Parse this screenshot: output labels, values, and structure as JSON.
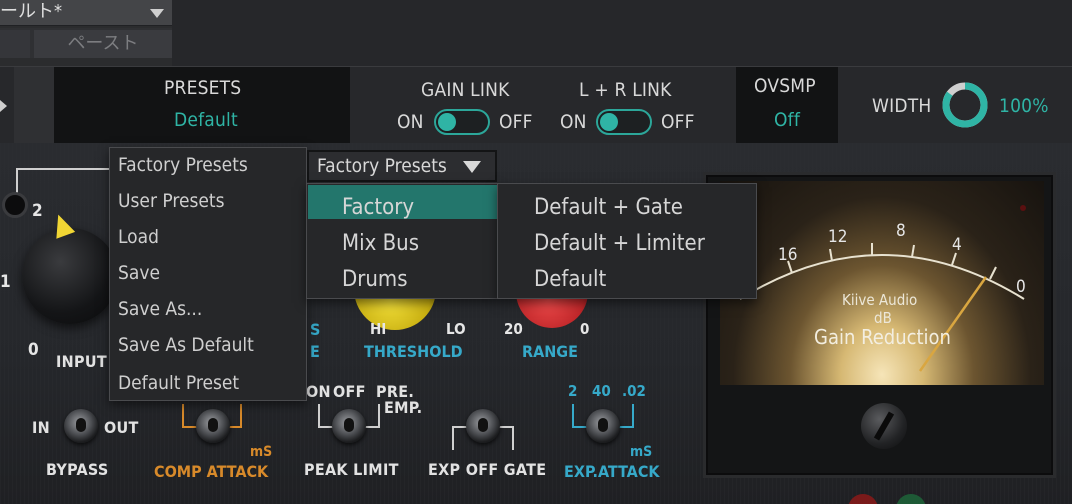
{
  "host": {
    "preset_name": "ールト*",
    "paste_label": "ペースト"
  },
  "topbar": {
    "presets_label": "PRESETS",
    "presets_value": "Default",
    "gain_link_label": "GAIN LINK",
    "gain_link_on": "ON",
    "gain_link_off": "OFF",
    "lr_link_label": "L + R LINK",
    "lr_link_on": "ON",
    "lr_link_off": "OFF",
    "ovsmp_label": "OVSMP",
    "ovsmp_value": "Off",
    "width_label": "WIDTH",
    "width_value": "100%",
    "width_level": 0.85
  },
  "controls": {
    "input_label": "INPUT",
    "input_scale": [
      "2",
      "1",
      "0"
    ],
    "bypass_label": "BYPASS",
    "bypass_in": "IN",
    "bypass_out": "OUT",
    "comp_attack_label": "COMP ATTACK",
    "comp_attack_unit": "mS",
    "peak_limit_label": "PEAK LIMIT",
    "peak_on": "ON",
    "peak_off": "OFF",
    "peak_pre": "PRE.",
    "peak_emp": "EMP.",
    "exp_gate_label": "EXP OFF GATE",
    "exp_attack_label": "EXP.ATTACK",
    "exp_attack_scale": [
      "2",
      "40",
      ".02"
    ],
    "exp_attack_unit": "mS",
    "threshold_label": "THRESHOLD",
    "threshold_hi": "HI",
    "threshold_lo": "LO",
    "range_label": "RANGE",
    "range_min": "20",
    "range_max": "0",
    "partial_left_top": "S",
    "partial_left_bottom": "E"
  },
  "meter": {
    "scale": [
      "16",
      "12",
      "8",
      "4",
      "0"
    ],
    "brand": "Kiive Audio",
    "unit": "dB",
    "title": "Gain Reduction"
  },
  "presets_menu": {
    "items": [
      "Factory Presets",
      "User Presets",
      "Load",
      "Save",
      "Save As...",
      "Save As Default",
      "Default Preset"
    ]
  },
  "factory_menu": {
    "header": "Factory Presets",
    "categories": [
      "Factory",
      "Mix Bus",
      "Drums"
    ],
    "selected_category": "Factory",
    "presets": [
      "Default + Gate",
      "Default + Limiter",
      "Default"
    ]
  },
  "colors": {
    "accent": "#2fb4a5",
    "selected": "#23766c"
  }
}
